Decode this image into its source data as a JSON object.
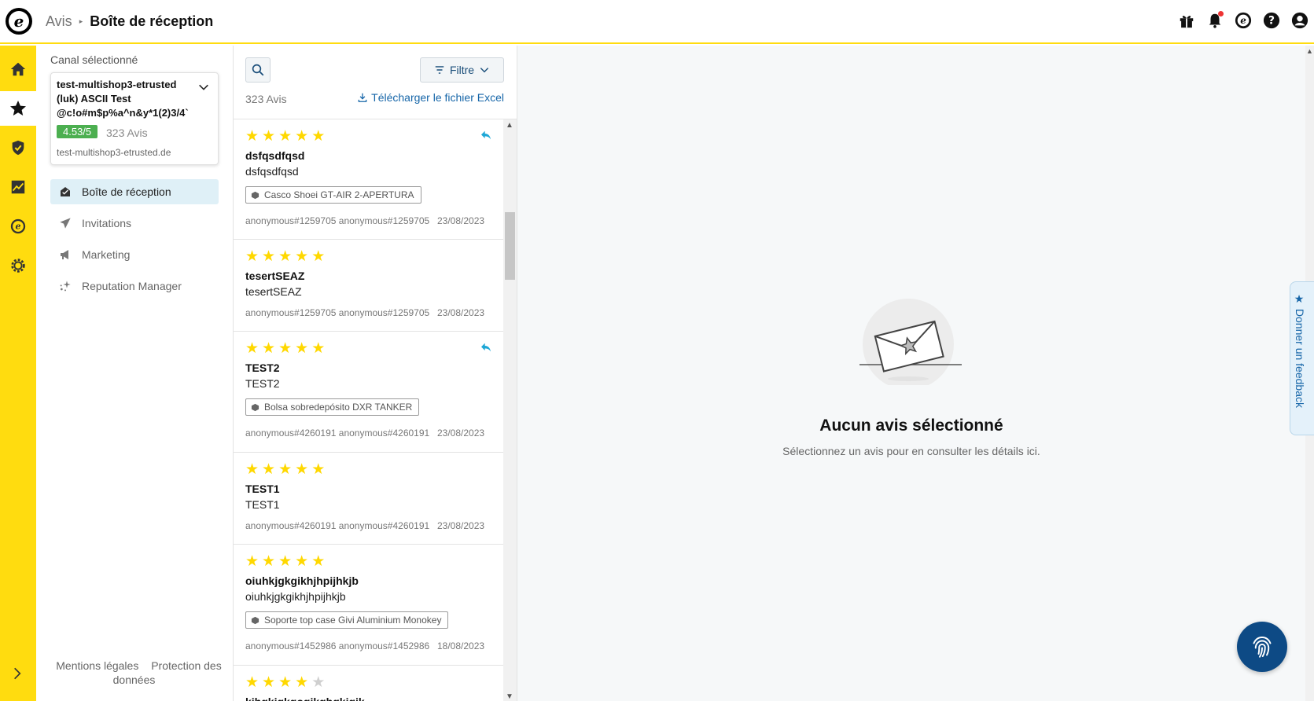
{
  "header": {
    "breadcrumb_root": "Avis",
    "breadcrumb_current": "Boîte de réception"
  },
  "sidebar": {
    "channel_label": "Canal sélectionné",
    "channel": {
      "name": "test-multishop3-etrusted (luk) ASCII Test @c!o#m$p%a^n&y*1(2)3/4`",
      "rating": "4.53/5",
      "review_count": "323 Avis",
      "url": "test-multishop3-etrusted.de"
    },
    "nav": [
      {
        "label": "Boîte de réception",
        "icon": "inbox-icon",
        "active": true
      },
      {
        "label": "Invitations",
        "icon": "paper-plane-icon",
        "active": false
      },
      {
        "label": "Marketing",
        "icon": "megaphone-icon",
        "active": false
      },
      {
        "label": "Reputation Manager",
        "icon": "sparkle-icon",
        "active": false
      }
    ],
    "footer": {
      "legal": "Mentions légales",
      "privacy": "Protection des données"
    }
  },
  "list": {
    "filter_label": "Filtre",
    "count": "323 Avis",
    "excel_label": "Télécharger le fichier Excel",
    "reviews": [
      {
        "stars": 5,
        "title": "dsfqsdfqsd",
        "body": "dsfqsdfqsd",
        "product": "Casco Shoei GT-AIR 2-APERTURA",
        "author": "anonymous#1259705 anonymous#1259705",
        "date": "23/08/2023",
        "replied": true
      },
      {
        "stars": 5,
        "title": "tesertSEAZ",
        "body": "tesertSEAZ",
        "product": "",
        "author": "anonymous#1259705 anonymous#1259705",
        "date": "23/08/2023",
        "replied": false
      },
      {
        "stars": 5,
        "title": "TEST2",
        "body": "TEST2",
        "product": "Bolsa sobredepósito DXR TANKER",
        "author": "anonymous#4260191 anonymous#4260191",
        "date": "23/08/2023",
        "replied": true
      },
      {
        "stars": 5,
        "title": "TEST1",
        "body": "TEST1",
        "product": "",
        "author": "anonymous#4260191 anonymous#4260191",
        "date": "23/08/2023",
        "replied": false
      },
      {
        "stars": 5,
        "title": "oiuhkjgkgikhjhpijhkjb",
        "body": "oiuhkjgkgikhjhpijhkjb",
        "product": "Soporte top case Givi Aluminium Monokey",
        "author": "anonymous#1452986 anonymous#1452986",
        "date": "18/08/2023",
        "replied": false
      },
      {
        "stars": 4,
        "title": "kjhgkjgkgogjkghgkjgjk",
        "body": "",
        "product": "",
        "author": "",
        "date": "",
        "replied": false
      }
    ]
  },
  "detail": {
    "empty_title": "Aucun avis sélectionné",
    "empty_subtitle": "Sélectionnez un avis pour en consulter les détails ici."
  },
  "feedback_tab": "Donner un feedback",
  "colors": {
    "brand_yellow": "#ffdc0f",
    "star": "#ffd800",
    "rating_badge": "#4caf50",
    "link": "#1565a8",
    "reply_icon": "#1ea7d6"
  }
}
